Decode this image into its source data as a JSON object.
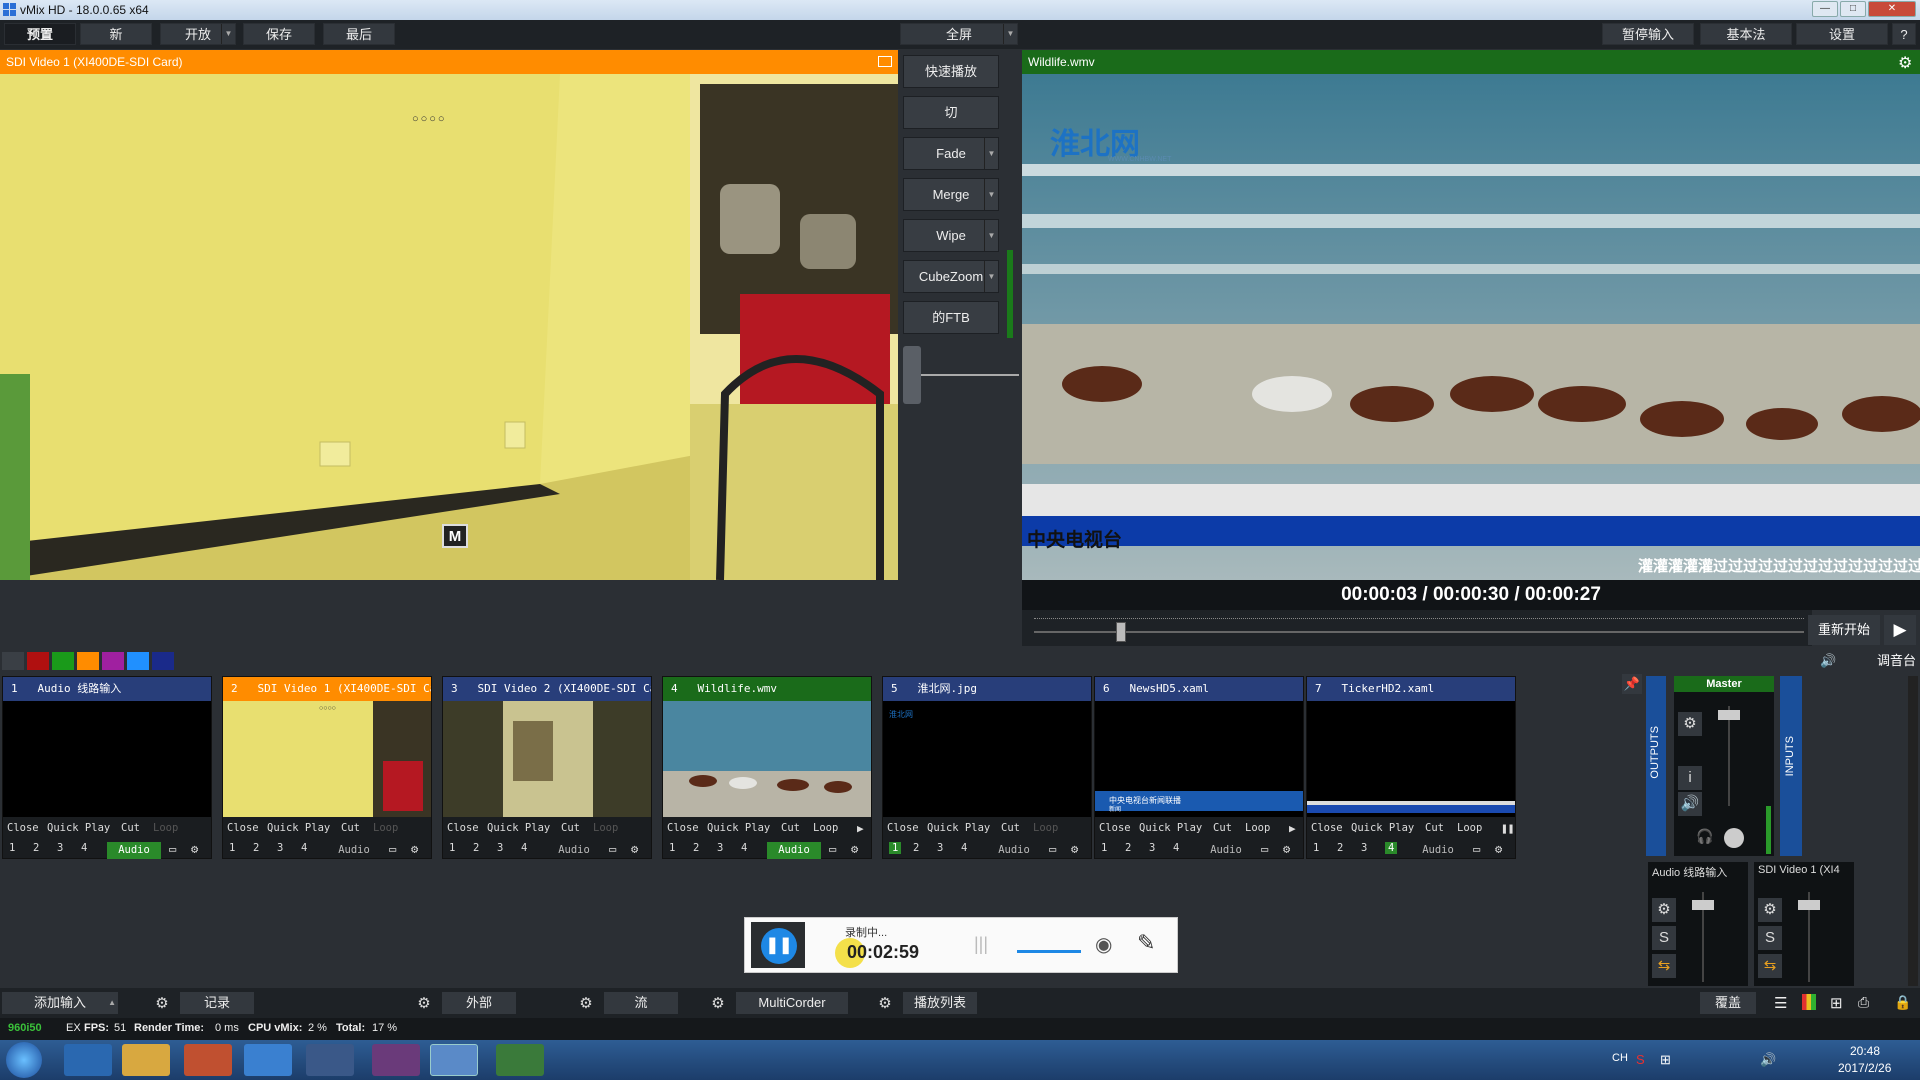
{
  "window": {
    "title": "vMix HD - 18.0.0.65 x64",
    "min": "—",
    "max": "□",
    "close": "✕"
  },
  "menu": {
    "preset": "预置",
    "new": "新",
    "open": "开放",
    "save": "保存",
    "last": "最后",
    "fullscreen": "全屏",
    "pause_input": "暂停输入",
    "basic": "基本法",
    "settings": "设置",
    "help": "?"
  },
  "preview": {
    "title": "SDI Video 1 (XI400DE-SDI Card)",
    "overlay_dots": "○○○○",
    "m_label": "M"
  },
  "output": {
    "title": "Wildlife.wmv",
    "logo_text": "淮北网",
    "logo_sub": "WWW.CNHBW.NET",
    "lower_third": "中央电视台",
    "ticker": "灌灌灌灌灌过过过过过过过过过过过过过过",
    "time_position": "00:00:03",
    "time_duration": "00:00:30",
    "time_remaining": "00:00:27",
    "time_sep": "/",
    "restart": "重新开始",
    "mixer_label": "调音台"
  },
  "transitions": {
    "quickplay": "快速播放",
    "cut": "切",
    "fade": "Fade",
    "merge": "Merge",
    "wipe": "Wipe",
    "cubezoom": "CubeZoom",
    "ftb": "的FTB"
  },
  "swatch_colors": [
    "#3a3f45",
    "#b01010",
    "#1a9a1a",
    "#ff8c00",
    "#a020a0",
    "#2090ff",
    "#1a2a8a"
  ],
  "inputs": [
    {
      "num": "1",
      "name": "Audio 线路输入",
      "state": "normal",
      "close": "Close",
      "quickplay": "Quick Play",
      "cut": "Cut",
      "loop": "Loop",
      "loop_active": false,
      "audio": "Audio",
      "audio_on": true,
      "play_icon": "",
      "b1": "1",
      "b2": "2",
      "b3": "3",
      "b4": "4",
      "active_num": ""
    },
    {
      "num": "2",
      "name": "SDI Video 1 (XI400DE-SDI Card)",
      "state": "preview",
      "close": "Close",
      "quickplay": "Quick Play",
      "cut": "Cut",
      "loop": "Loop",
      "loop_active": false,
      "audio": "Audio",
      "audio_on": false,
      "play_icon": "",
      "b1": "1",
      "b2": "2",
      "b3": "3",
      "b4": "4",
      "active_num": ""
    },
    {
      "num": "3",
      "name": "SDI Video 2 (XI400DE-SDI Card)",
      "state": "normal",
      "close": "Close",
      "quickplay": "Quick Play",
      "cut": "Cut",
      "loop": "Loop",
      "loop_active": false,
      "audio": "Audio",
      "audio_on": false,
      "play_icon": "",
      "b1": "1",
      "b2": "2",
      "b3": "3",
      "b4": "4",
      "active_num": ""
    },
    {
      "num": "4",
      "name": "Wildlife.wmv",
      "state": "live",
      "close": "Close",
      "quickplay": "Quick Play",
      "cut": "Cut",
      "loop": "Loop",
      "loop_active": true,
      "audio": "Audio",
      "audio_on": true,
      "play_icon": "▶",
      "b1": "1",
      "b2": "2",
      "b3": "3",
      "b4": "4",
      "active_num": ""
    },
    {
      "num": "5",
      "name": "淮北网.jpg",
      "state": "normal",
      "close": "Close",
      "quickplay": "Quick Play",
      "cut": "Cut",
      "loop": "Loop",
      "loop_active": false,
      "audio": "Audio",
      "audio_on": false,
      "play_icon": "",
      "b1": "1",
      "b2": "2",
      "b3": "3",
      "b4": "4",
      "active_num": "1"
    },
    {
      "num": "6",
      "name": "NewsHD5.xaml",
      "state": "normal",
      "close": "Close",
      "quickplay": "Quick Play",
      "cut": "Cut",
      "loop": "Loop",
      "loop_active": true,
      "audio": "Audio",
      "audio_on": false,
      "play_icon": "▶",
      "b1": "1",
      "b2": "2",
      "b3": "3",
      "b4": "4",
      "active_num": ""
    },
    {
      "num": "7",
      "name": "TickerHD2.xaml",
      "state": "normal",
      "close": "Close",
      "quickplay": "Quick Play",
      "cut": "Cut",
      "loop": "Loop",
      "loop_active": true,
      "audio": "Audio",
      "audio_on": false,
      "play_icon": "❚❚",
      "b1": "1",
      "b2": "2",
      "b3": "3",
      "b4": "4",
      "active_num": "4"
    }
  ],
  "input_thumbs": {
    "news_text": "中央电视台新闻联播",
    "news_sub": "新闻",
    "sdi_dots": "○○○○"
  },
  "mixer": {
    "outputs": "OUTPUTS",
    "inputs": "INPUTS",
    "master": "Master",
    "info": "i",
    "strip1": "Audio 线路输入",
    "strip2": "SDI Video 1 (XI4",
    "solo": "S"
  },
  "recorder": {
    "status": "录制中...",
    "time": "00:02:59"
  },
  "bottom": {
    "add_input": "添加输入",
    "record": "记录",
    "external": "外部",
    "stream": "流",
    "multicorder": "MultiCorder",
    "playlist": "播放列表",
    "overlay": "覆盖"
  },
  "status": {
    "resolution": "960i50",
    "ex": "EX",
    "fps_label": "FPS:",
    "fps": "51",
    "render_label": "Render Time:",
    "render": "0 ms",
    "cpu_label": "CPU vMix:",
    "cpu": "2 %",
    "total_label": "Total:",
    "total": "17 %"
  },
  "taskbar": {
    "lang": "CH",
    "time": "20:48",
    "date": "2017/2/26"
  }
}
